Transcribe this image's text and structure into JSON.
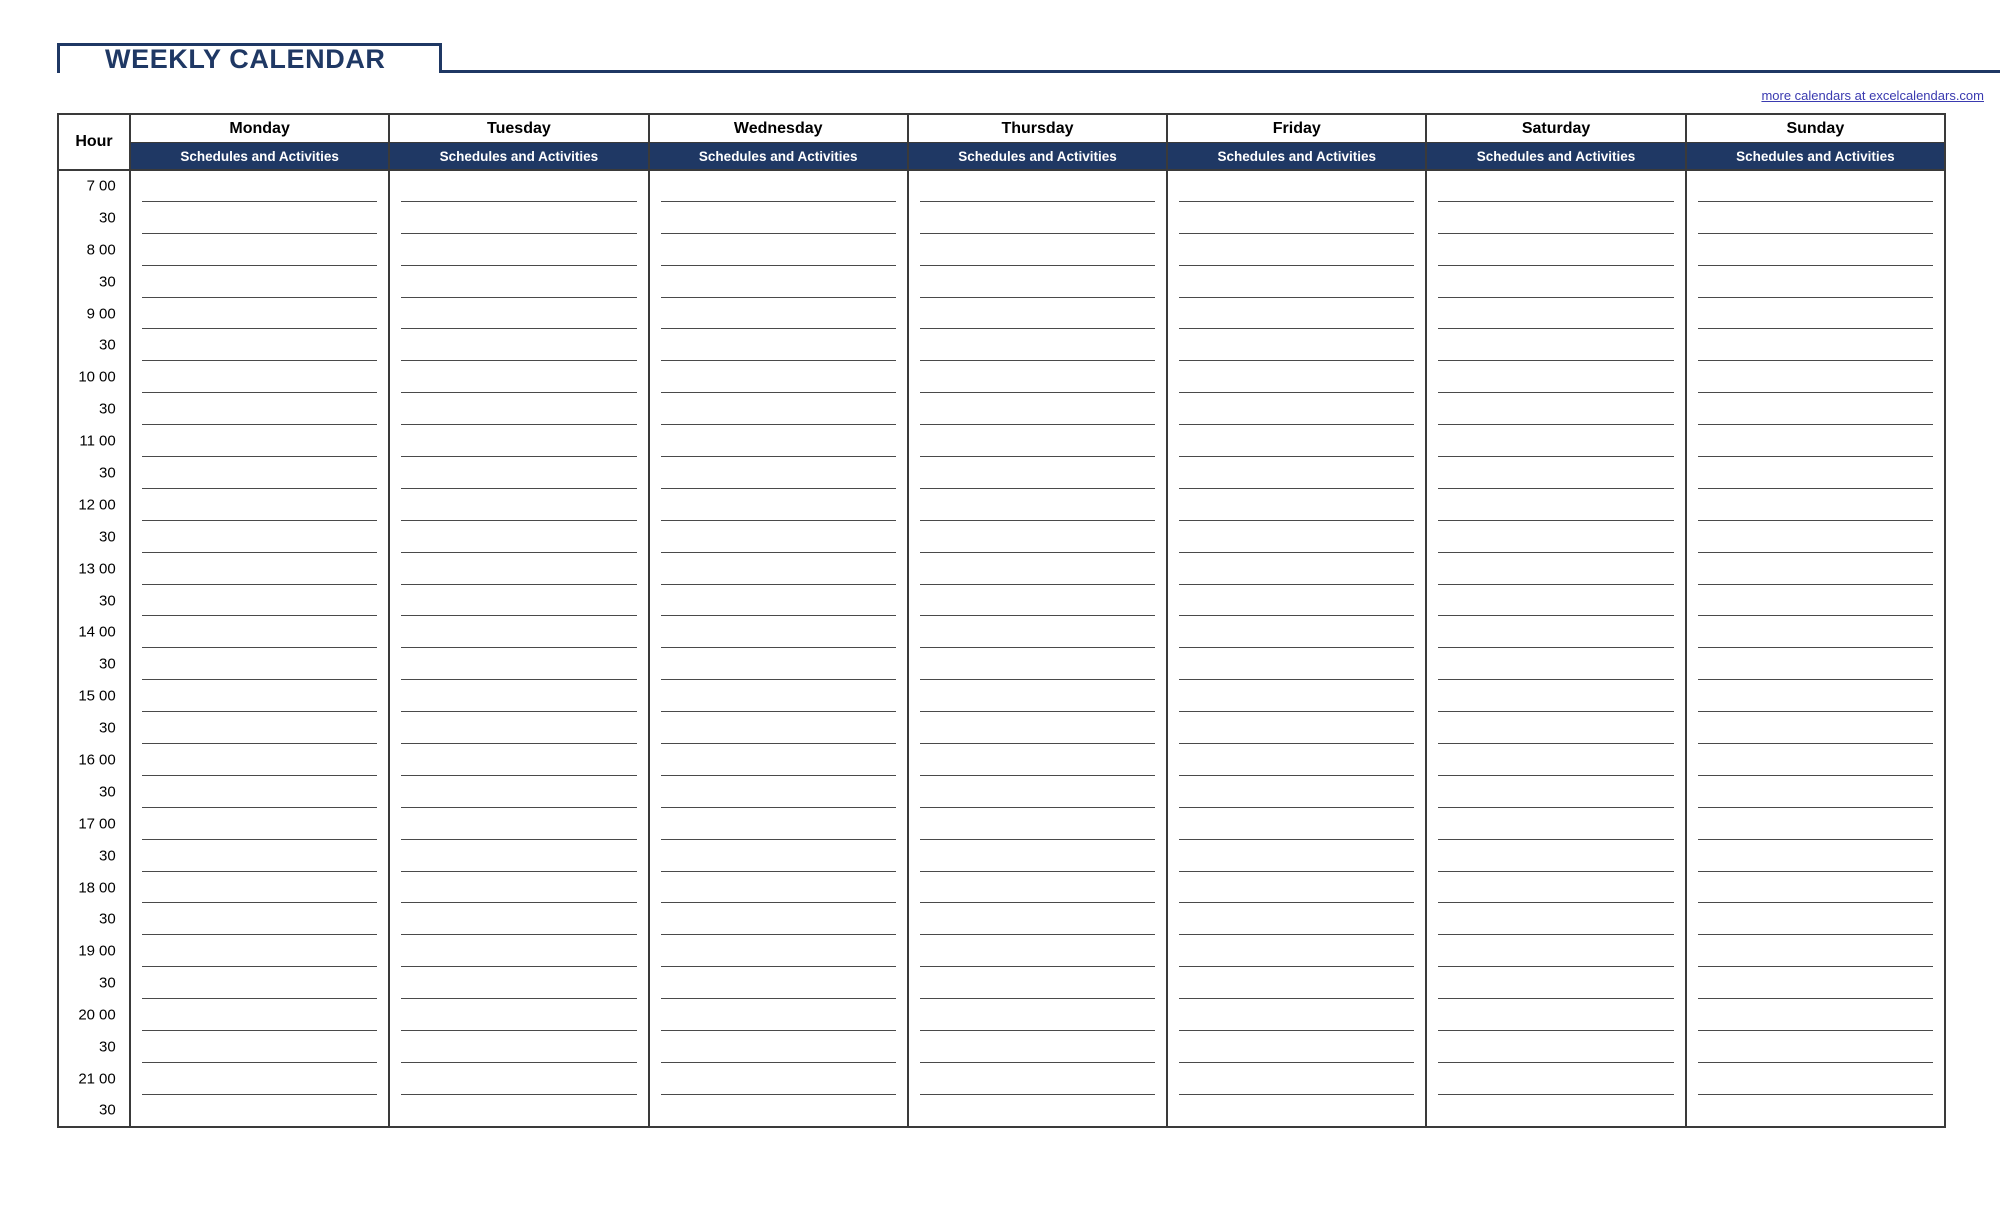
{
  "header": {
    "title": "WEEKLY CALENDAR",
    "promo_link": "more calendars at excelcalendars.com",
    "accent_color": "#1f3864",
    "link_color": "#3a3ab0"
  },
  "table": {
    "hour_column_label": "Hour",
    "subheader_label": "Schedules and Activities",
    "days": [
      "Monday",
      "Tuesday",
      "Wednesday",
      "Thursday",
      "Friday",
      "Saturday",
      "Sunday"
    ],
    "time_slots": [
      {
        "hour": "7",
        "minute": "00"
      },
      {
        "hour": "",
        "minute": "30"
      },
      {
        "hour": "8",
        "minute": "00"
      },
      {
        "hour": "",
        "minute": "30"
      },
      {
        "hour": "9",
        "minute": "00"
      },
      {
        "hour": "",
        "minute": "30"
      },
      {
        "hour": "10",
        "minute": "00"
      },
      {
        "hour": "",
        "minute": "30"
      },
      {
        "hour": "11",
        "minute": "00"
      },
      {
        "hour": "",
        "minute": "30"
      },
      {
        "hour": "12",
        "minute": "00"
      },
      {
        "hour": "",
        "minute": "30"
      },
      {
        "hour": "13",
        "minute": "00"
      },
      {
        "hour": "",
        "minute": "30"
      },
      {
        "hour": "14",
        "minute": "00"
      },
      {
        "hour": "",
        "minute": "30"
      },
      {
        "hour": "15",
        "minute": "00"
      },
      {
        "hour": "",
        "minute": "30"
      },
      {
        "hour": "16",
        "minute": "00"
      },
      {
        "hour": "",
        "minute": "30"
      },
      {
        "hour": "17",
        "minute": "00"
      },
      {
        "hour": "",
        "minute": "30"
      },
      {
        "hour": "18",
        "minute": "00"
      },
      {
        "hour": "",
        "minute": "30"
      },
      {
        "hour": "19",
        "minute": "00"
      },
      {
        "hour": "",
        "minute": "30"
      },
      {
        "hour": "20",
        "minute": "00"
      },
      {
        "hour": "",
        "minute": "30"
      },
      {
        "hour": "21",
        "minute": "00"
      },
      {
        "hour": "",
        "minute": "30"
      }
    ]
  }
}
